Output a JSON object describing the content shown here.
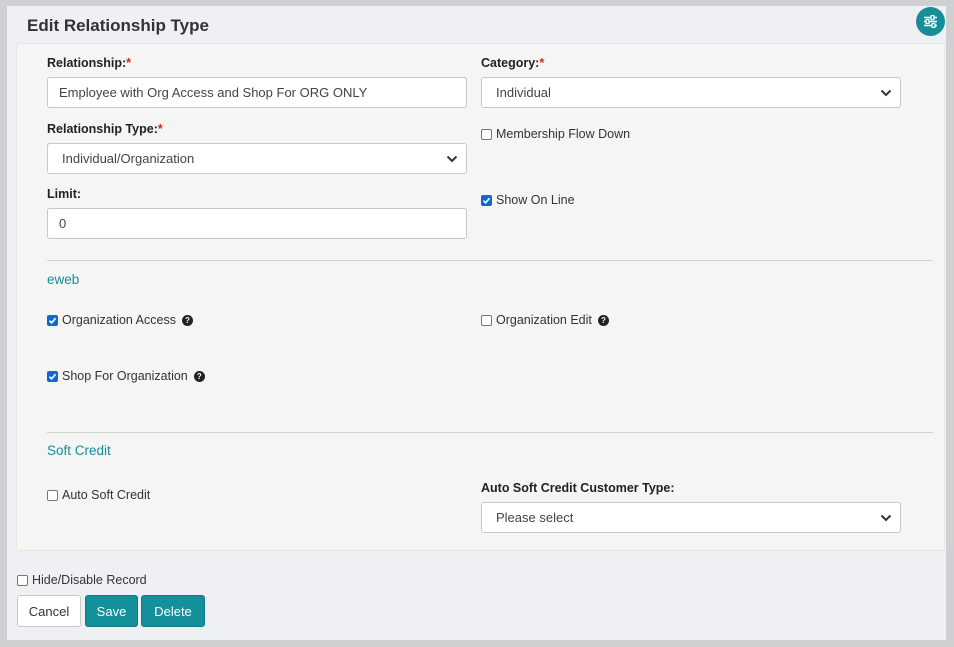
{
  "title": "Edit Relationship Type",
  "icons": {
    "settings": "sliders-icon",
    "help": "question-circle-icon",
    "chevron": "chevron-down-icon"
  },
  "colors": {
    "accent": "#188c97",
    "required": "#d9261c",
    "checkbox": "#0b6bd6"
  },
  "form": {
    "relationship": {
      "label": "Relationship:",
      "required": "*",
      "value": "Employee with Org Access and Shop For ORG ONLY"
    },
    "category": {
      "label": "Category:",
      "required": "*",
      "value": "Individual"
    },
    "relationship_type": {
      "label": "Relationship Type:",
      "required": "*",
      "value": "Individual/Organization"
    },
    "membership_flow_down": {
      "label": "Membership Flow Down",
      "checked": false
    },
    "limit": {
      "label": "Limit:",
      "value": "0"
    },
    "show_on_line": {
      "label": "Show On Line",
      "checked": true
    }
  },
  "eweb": {
    "heading": "eweb",
    "organization_access": {
      "label": "Organization Access",
      "checked": true
    },
    "organization_edit": {
      "label": "Organization Edit",
      "checked": false
    },
    "shop_for_organization": {
      "label": "Shop For Organization",
      "checked": true
    }
  },
  "soft_credit": {
    "heading": "Soft Credit",
    "auto_soft_credit": {
      "label": "Auto Soft Credit",
      "checked": false
    },
    "customer_type": {
      "label": "Auto Soft Credit Customer Type:",
      "value": "Please select"
    }
  },
  "hide_disable": {
    "label": "Hide/Disable Record",
    "checked": false
  },
  "buttons": {
    "cancel": "Cancel",
    "save": "Save",
    "delete": "Delete"
  }
}
